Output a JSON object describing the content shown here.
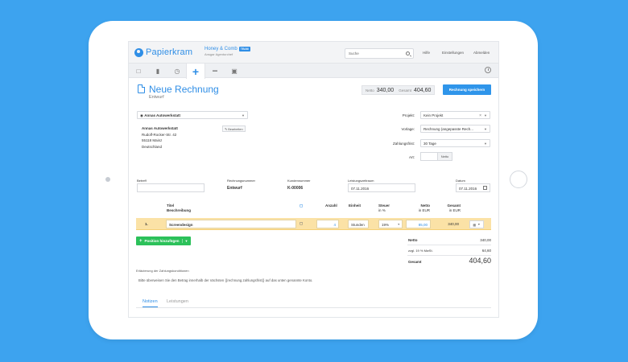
{
  "app": {
    "name": "Papierkram"
  },
  "company": {
    "name": "Honey & Comb",
    "badge": "TEAM",
    "subtitle": "Ansgar Agenturchef"
  },
  "header": {
    "search_placeholder": "Suche",
    "nav": [
      "Hilfe",
      "Einstellungen",
      "Abmelden"
    ]
  },
  "toolbar": {
    "items": [
      "laptop-icon",
      "folder-icon",
      "clock-icon",
      "plus-icon",
      "minus-icon",
      "image-icon"
    ],
    "active": "plus-icon"
  },
  "page": {
    "title": "Neue Rechnung",
    "status": "Entwurf",
    "totals": {
      "netto_label": "Netto",
      "netto_value": "340,00",
      "gesamt_label": "Gesamt",
      "gesamt_value": "404,60"
    },
    "save_label": "Rechnung speichern"
  },
  "customer": {
    "selected": "Annas Autowerkstatt",
    "edit_label": "Bearbeiten",
    "address": [
      "Annas Autowerkstatt",
      "Rudolf-Rocker-Str. 42",
      "55118 Mainz",
      "Deutschland"
    ]
  },
  "form": {
    "projekt": {
      "label": "Projekt:",
      "value": "Kein Projekt"
    },
    "vorlage": {
      "label": "Vorlage:",
      "value": "Rechnung (angepasste Rech..."
    },
    "zahlungsfrist": {
      "label": "Zahlungsfrist:",
      "value": "30 Tage"
    },
    "art": {
      "label": "Art:",
      "option": "Netto"
    }
  },
  "meta": {
    "betreff": {
      "label": "Betreff",
      "value": ""
    },
    "rechnungsnummer": {
      "label": "Rechnungsnummer",
      "value": "Entwurf"
    },
    "kundennummer": {
      "label": "Kundennummer",
      "value": "K-00006"
    },
    "leistungszeitraum": {
      "label": "Leistungszeitraum",
      "value": "07.11.2016"
    },
    "datum": {
      "label": "Datum",
      "value": "07.11.2016"
    }
  },
  "table": {
    "headers": {
      "titel": "Titel",
      "beschreibung": "Beschreibung",
      "anzahl": "Anzahl",
      "einheit": "Einheit",
      "steuer": "Steuer",
      "steuer_unit": "in %",
      "netto": "Netto",
      "netto_unit": "in EUR",
      "gesamt": "Gesamt",
      "gesamt_unit": "in EUR"
    },
    "rows": [
      {
        "num": "1.",
        "title": "Screendesign",
        "anzahl": "4",
        "einheit": "Stunden",
        "steuer": "19%",
        "netto": "85,00",
        "gesamt": "340,00"
      }
    ]
  },
  "add_position_label": "Position hinzufügen",
  "summary": {
    "netto_label": "Netto",
    "netto_value": "340,00",
    "mwst_label": "zzgl. 19 % MwSt.",
    "mwst_value": "64,60",
    "gesamt_label": "Gesamt",
    "gesamt_value": "404,60"
  },
  "terms": {
    "heading": "Erläuterung der Zahlungskonditionen",
    "text": "Bitte überweisen Sie den Betrag innerhalb der nächsten {{rechnung.zahlungsfrist}} auf das unten genannte Konto."
  },
  "tabs": [
    "Notizen",
    "Leistungen"
  ]
}
